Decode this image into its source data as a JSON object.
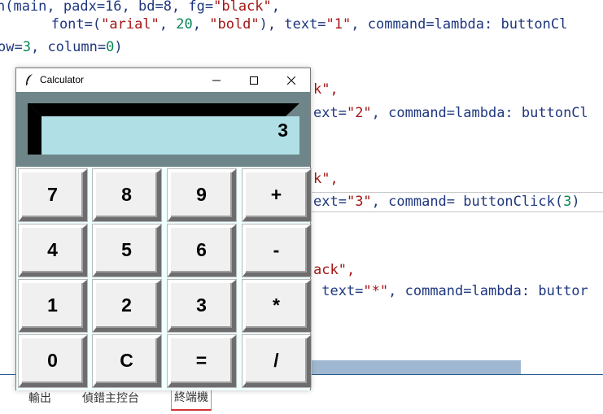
{
  "editor": {
    "lines": [
      {
        "segments": [
          {
            "t": "n(main, padx=16, bd=8, fg=",
            "c": "text"
          },
          {
            "t": "\"black\"",
            "c": "str"
          },
          {
            "t": ",",
            "c": "text"
          }
        ]
      },
      {
        "segments": [
          {
            "t": "   font=(",
            "c": "text"
          },
          {
            "t": "\"arial\"",
            "c": "str"
          },
          {
            "t": ", ",
            "c": "text"
          },
          {
            "t": "20",
            "c": "num"
          },
          {
            "t": ", ",
            "c": "text"
          },
          {
            "t": "\"bold\"",
            "c": "str"
          },
          {
            "t": "), text=",
            "c": "text"
          },
          {
            "t": "\"1\"",
            "c": "str"
          },
          {
            "t": ", command=lambda: buttonCl",
            "c": "text"
          }
        ]
      },
      {
        "segments": [
          {
            "t": "ow=",
            "c": "text"
          },
          {
            "t": "3",
            "c": "num"
          },
          {
            "t": ", column=",
            "c": "text"
          },
          {
            "t": "0",
            "c": "num"
          },
          {
            "t": ")",
            "c": "text"
          }
        ]
      },
      {
        "segments": [
          {
            "t": "k\",",
            "c": "str"
          }
        ]
      },
      {
        "segments": [
          {
            "t": "ext=",
            "c": "text"
          },
          {
            "t": "\"2\"",
            "c": "str"
          },
          {
            "t": ", command=lambda: buttonCl",
            "c": "text"
          }
        ]
      },
      {
        "segments": [
          {
            "t": "k\",",
            "c": "str"
          }
        ]
      },
      {
        "segments": [
          {
            "t": "ext=",
            "c": "text"
          },
          {
            "t": "\"3\"",
            "c": "str"
          },
          {
            "t": ", command= buttonClick(",
            "c": "text"
          },
          {
            "t": "3",
            "c": "num"
          },
          {
            "t": ")",
            "c": "text"
          }
        ]
      },
      {
        "segments": [
          {
            "t": "ack\",",
            "c": "str"
          }
        ]
      },
      {
        "segments": [
          {
            "t": " text=",
            "c": "text"
          },
          {
            "t": "\"*\"",
            "c": "str"
          },
          {
            "t": ", command=lambda: buttor",
            "c": "text"
          }
        ]
      }
    ]
  },
  "panel": {
    "tabs": [
      "輸出",
      "偵錯主控台",
      "終端機"
    ],
    "active_tab": "終端機"
  },
  "calculator": {
    "title": "Calculator",
    "display_value": "3",
    "keys": [
      [
        "7",
        "8",
        "9",
        "+"
      ],
      [
        "4",
        "5",
        "6",
        "-"
      ],
      [
        "1",
        "2",
        "3",
        "*"
      ],
      [
        "0",
        "C",
        "=",
        "/"
      ]
    ],
    "colors": {
      "display_bg": "#b0e0e6",
      "frame_bg": "#6e868a",
      "key_face": "#f0f0f0",
      "grid_bg": "#f0ffff"
    }
  }
}
